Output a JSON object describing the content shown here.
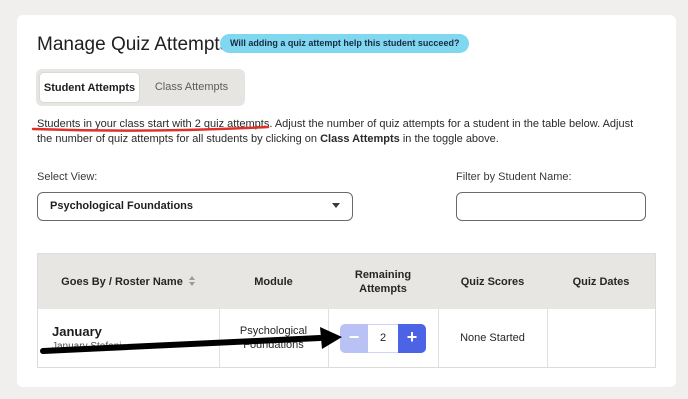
{
  "page": {
    "title": "Manage Quiz Attempts",
    "help_pill": "Will adding a quiz attempt help this student succeed?"
  },
  "toggle": {
    "student_attempts": "Student Attempts",
    "class_attempts": "Class Attempts",
    "active": "Student Attempts"
  },
  "description": {
    "part1": "Students in your class start with 2 quiz attempts. Adjust the number of quiz attempts for a student in the table below. Adjust the number of quiz attempts for all students by clicking on ",
    "bold": "Class Attempts",
    "part2": " in the toggle above."
  },
  "filters": {
    "select_label": "Select View:",
    "select_value": "Psychological Foundations",
    "filter_label": "Filter by Student Name:",
    "filter_value": ""
  },
  "table": {
    "headers": [
      "Goes By / Roster Name",
      "Module",
      "Remaining Attempts",
      "Quiz Scores",
      "Quiz Dates"
    ],
    "rows": [
      {
        "name": "January",
        "roster_name": "January Stefani",
        "module": "Psychological Foundations",
        "remaining_attempts": "2",
        "quiz_scores": "None Started",
        "quiz_dates": ""
      }
    ]
  },
  "stepper": {
    "minus": "−",
    "plus": "+"
  },
  "colors": {
    "pill": "#7fd8f0",
    "stepper_plus": "#4d63e6",
    "stepper_minus": "#b9c1f5",
    "annotation_underline": "#e0302a",
    "annotation_arrow": "#000000"
  }
}
